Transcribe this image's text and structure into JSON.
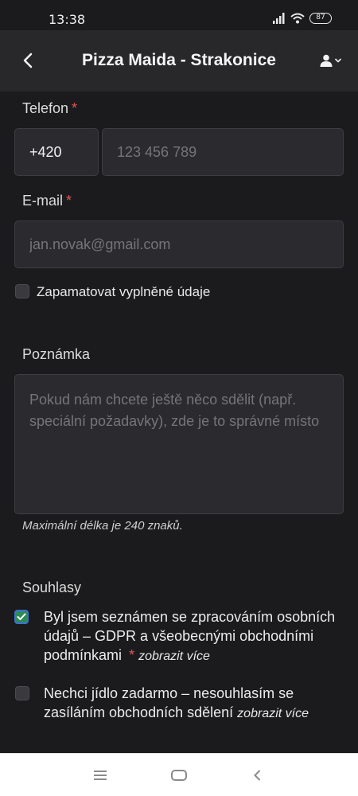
{
  "status": {
    "time": "13:38",
    "battery": "87"
  },
  "header": {
    "title": "Pizza Maida - Strakonice"
  },
  "phone": {
    "label": "Telefon",
    "required": "*",
    "prefix": "+420",
    "placeholder": "123 456 789"
  },
  "email": {
    "label": "E-mail",
    "required": "*",
    "placeholder": "jan.novak@gmail.com"
  },
  "remember": {
    "label": "Zapamatovat vyplněné údaje"
  },
  "note": {
    "label": "Poznámka",
    "placeholder": "Pokud nám chcete ještě něco sdělit (např. speciální požadavky), zde je to správné místo",
    "hint": "Maximální délka je 240 znaků."
  },
  "consents": {
    "label": "Souhlasy",
    "gdpr": {
      "text": "Byl jsem seznámen se zpracováním osobních údajů – GDPR a všeobecnými obchodními podmínkami",
      "required": "*",
      "more": "zobrazit více",
      "checked": true
    },
    "marketing": {
      "text": "Nechci jídlo zadarmo – nesouhlasím se zasíláním obchodních sdělení",
      "more": "zobrazit více",
      "checked": false
    }
  },
  "colors": {
    "background": "#1b1b1d",
    "header": "#28282b",
    "field": "#2b2b2f",
    "required": "#e05757",
    "check": "#2e8b57"
  }
}
